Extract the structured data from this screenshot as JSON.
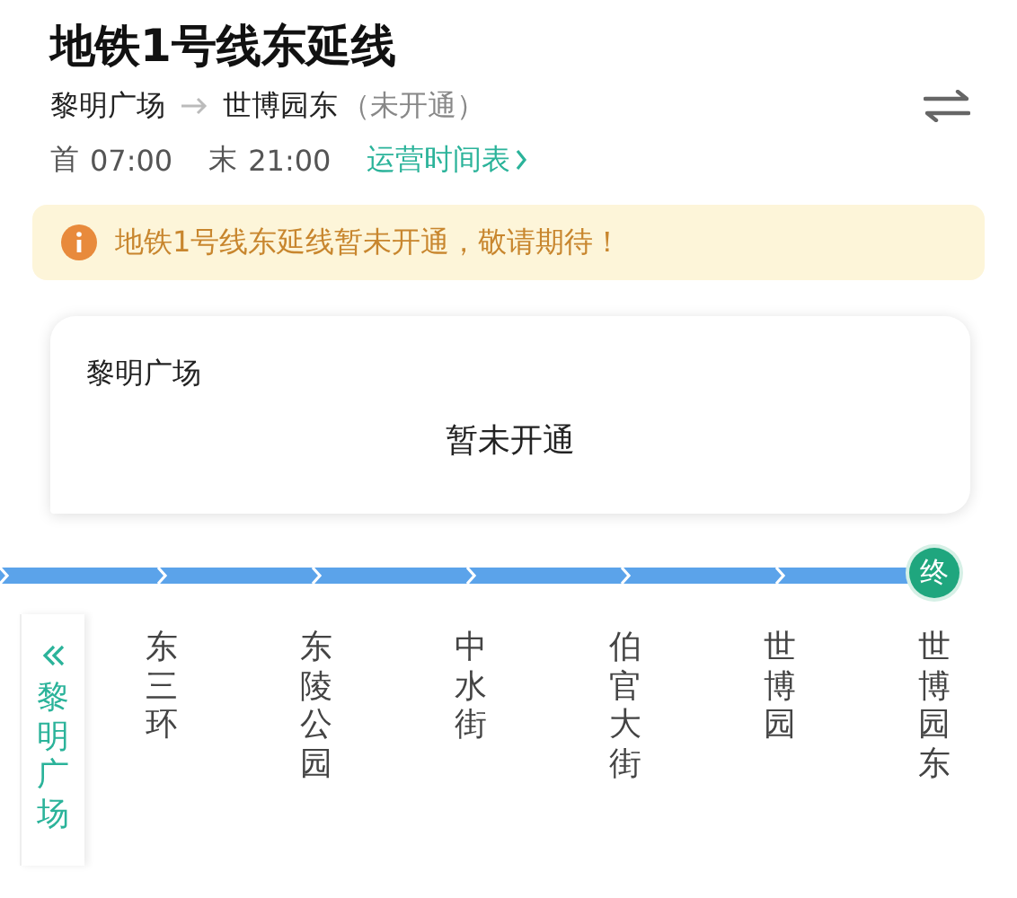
{
  "title": "地铁1号线东延线",
  "route": {
    "from": "黎明广场",
    "to": "世博园东",
    "status": "（未开通）"
  },
  "hours": {
    "first_label": "首",
    "first_time": "07:00",
    "last_label": "末",
    "last_time": "21:00",
    "timetable_link": "运营时间表"
  },
  "notice": "地铁1号线东延线暂未开通，敬请期待！",
  "card": {
    "station": "黎明广场",
    "status": "暂未开通"
  },
  "line": {
    "terminal_badge": "终",
    "stations": [
      {
        "name": "黎明广场",
        "selected": true
      },
      {
        "name": "东三环",
        "selected": false
      },
      {
        "name": "东陵公园",
        "selected": false
      },
      {
        "name": "中水街",
        "selected": false
      },
      {
        "name": "伯官大街",
        "selected": false
      },
      {
        "name": "世博园",
        "selected": false
      },
      {
        "name": "世博园东",
        "selected": false
      }
    ]
  }
}
